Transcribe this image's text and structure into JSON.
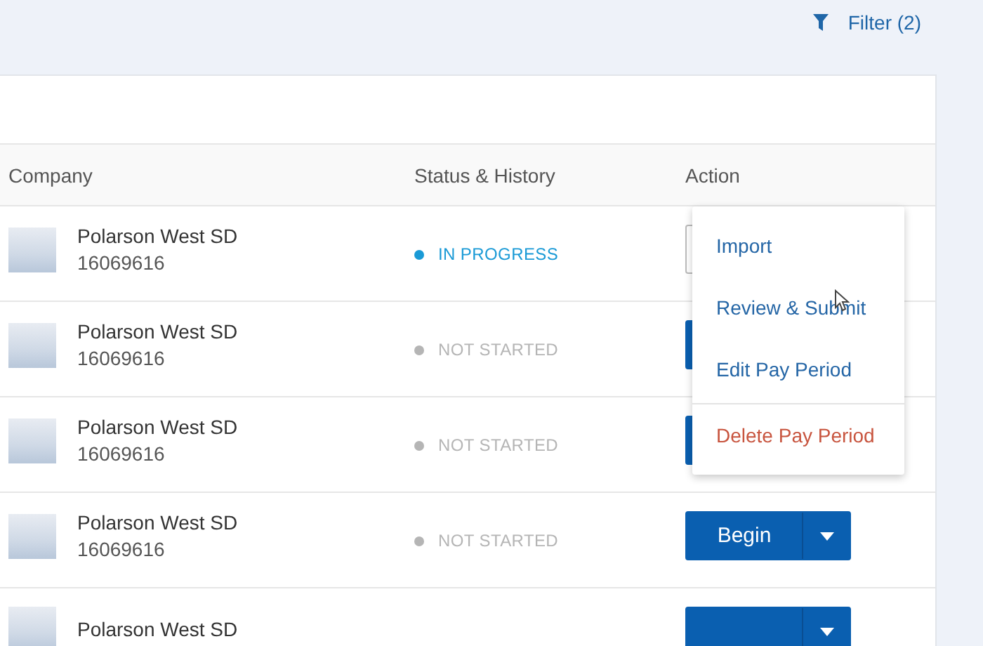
{
  "filter": {
    "label": "Filter (2)"
  },
  "table": {
    "columns": [
      "Company",
      "Status & History",
      "Action"
    ],
    "rows": [
      {
        "company": "Polarson West SD",
        "id": "16069616",
        "status": "IN PROGRESS",
        "color": "#1a9ad6",
        "button": {
          "kind": "outline"
        }
      },
      {
        "company": "Polarson West SD",
        "id": "16069616",
        "status": "NOT STARTED",
        "color": "#b5b5b5",
        "button": {
          "kind": "split"
        }
      },
      {
        "company": "Polarson West SD",
        "id": "16069616",
        "status": "NOT STARTED",
        "color": "#b5b5b5",
        "button": {
          "kind": "split"
        }
      },
      {
        "company": "Polarson West SD",
        "id": "16069616",
        "status": "NOT STARTED",
        "color": "#b5b5b5",
        "button": {
          "kind": "split",
          "label": "Begin"
        }
      },
      {
        "company": "Polarson West SD",
        "button": {
          "kind": "split"
        }
      }
    ]
  },
  "menu": {
    "items": [
      {
        "label": "Import",
        "kind": "normal"
      },
      {
        "label": "Review & Submit",
        "kind": "normal"
      },
      {
        "label": "Edit Pay Period",
        "kind": "normal"
      },
      {
        "label": "Delete Pay Period",
        "kind": "danger"
      }
    ]
  }
}
